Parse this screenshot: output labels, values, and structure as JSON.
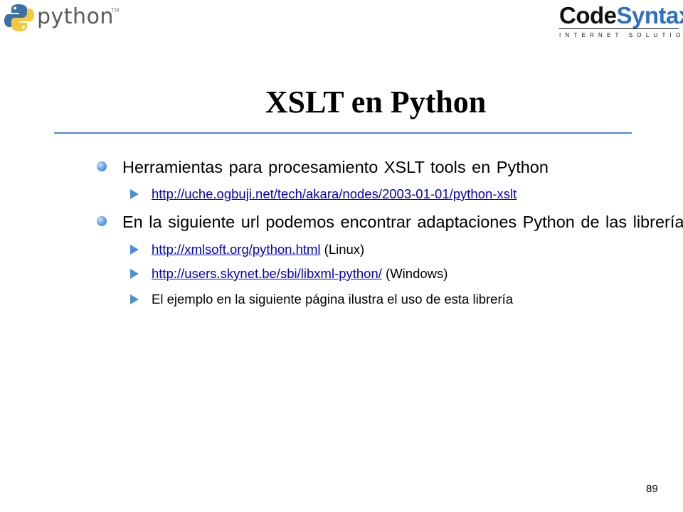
{
  "header": {
    "python_logo_text": "python",
    "python_logo_tm": "TM",
    "codesyntax_code": "Code",
    "codesyntax_syntax": "Syntax",
    "codesyntax_tagline": "INTERNET SOLUTIONS"
  },
  "slide": {
    "title": "XSLT en Python",
    "bullets": [
      {
        "text": "Herramientas para procesamiento XSLT tools en Python",
        "sub": [
          {
            "link": "http://uche.ogbuji.net/tech/akara/nodes/2003-01-01/python-xslt",
            "suffix": ""
          }
        ]
      },
      {
        "text": "En la siguiente url podemos encontrar adaptaciones Python de las librerías",
        "sub": [
          {
            "link": "http://xmlsoft.org/python.html",
            "suffix": " (Linux)"
          },
          {
            "link": "http://users.skynet.be/sbi/libxml-python/",
            "suffix": " (Windows)"
          },
          {
            "text": "El ejemplo en la siguiente página ilustra el uso de esta librería"
          }
        ]
      }
    ]
  },
  "footer": {
    "page_number": "89"
  },
  "colors": {
    "accent": "#4a86d4",
    "syntax_blue": "#2d6fc2",
    "link": "#0000cc",
    "bullet_arrow": "#4e8ed8"
  },
  "icons": {
    "level1_bullet": "blue-ball-bullet-icon",
    "level2_bullet": "blue-arrow-bullet-icon"
  }
}
